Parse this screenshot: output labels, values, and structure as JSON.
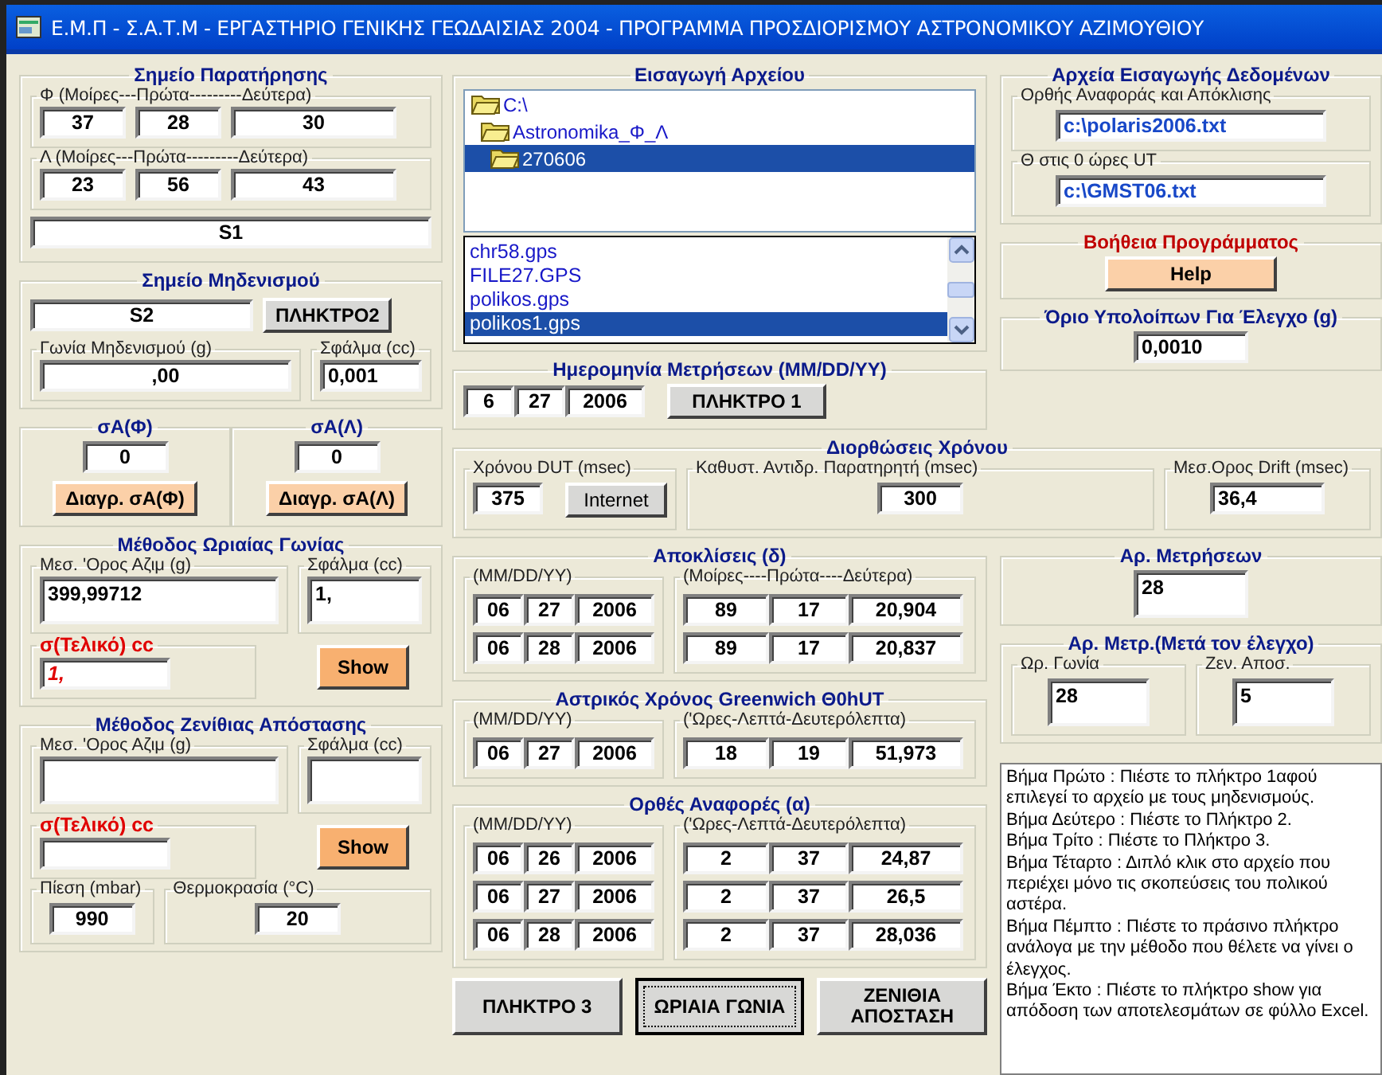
{
  "window": {
    "title": "Ε.Μ.Π - Σ.Α.Τ.Μ - ΕΡΓΑΣΤΗΡΙΟ ΓΕΝΙΚΗΣ ΓΕΩΔΑΙΣΙΑΣ 2004 - ΠΡΟΓΡΑΜΜΑ ΠΡΟΣΔΙΟΡΙΣΜΟΥ ΑΣΤΡΟΝΟΜΙΚΟΥ ΑΖΙΜΟΥΘΙΟΥ"
  },
  "observation_point": {
    "title": "Σημείο Παρατήρησης",
    "coords": [
      {
        "label": "Φ (Μοίρες---Πρώτα---------Δεύτερα)",
        "values": [
          "37",
          "28",
          "30"
        ]
      },
      {
        "label": "Λ (Μοίρες---Πρώτα---------Δεύτερα)",
        "values": [
          "23",
          "56",
          "43"
        ]
      }
    ],
    "name": "S1"
  },
  "zeroing_point": {
    "title": "Σημείο Μηδενισμού",
    "name": "S2",
    "button": "ΠΛΗΚΤΡΟ2",
    "angle": {
      "label": "Γωνία Μηδενισμού (g)",
      "value": ",00"
    },
    "error": {
      "label": "Σφάλμα (cc)",
      "value": "0,001"
    }
  },
  "sigma": [
    {
      "title": "σΑ(Φ)",
      "value": "0",
      "button": "Διαγρ. σΑ(Φ)"
    },
    {
      "title": "σΑ(Λ)",
      "value": "0",
      "button": "Διαγρ. σΑ(Λ)"
    }
  ],
  "methods": [
    {
      "title": "Μέθοδος Ωριαίας Γωνίας",
      "mean": {
        "label": "Μεσ. 'Ορος Αζιμ (g)",
        "value": "399,99712"
      },
      "error": {
        "label": "Σφάλμα (cc)",
        "value": "1,"
      },
      "final": {
        "label": "σ(Τελικό) cc",
        "value": "1,"
      },
      "button": "Show"
    },
    {
      "title": "Μέθοδος Ζενίθιας Απόστασης",
      "mean": {
        "label": "Μεσ. 'Ορος Αζιμ (g)"
      },
      "error": {
        "label": "Σφάλμα (cc)"
      },
      "final": {
        "label": "σ(Τελικό) cc"
      },
      "button": "Show"
    }
  ],
  "pressure": {
    "label": "Πίεση (mbar)",
    "value": "990"
  },
  "temperature": {
    "label": "Θερμοκρασία (°C)",
    "value": "20"
  },
  "file_input": {
    "title": "Εισαγωγή Αρχείου",
    "folders": [
      {
        "label": "C:\\",
        "selected": false,
        "children": [
          {
            "label": "Astronomika_Φ_Λ",
            "selected": false,
            "children": [
              {
                "label": "270606",
                "selected": true
              }
            ]
          }
        ]
      }
    ],
    "files": [
      {
        "label": "chr58.gps",
        "selected": false
      },
      {
        "label": "FILE27.GPS",
        "selected": false
      },
      {
        "label": "polikos.gps",
        "selected": false
      },
      {
        "label": "polikos1.gps",
        "selected": true
      }
    ]
  },
  "measurement_date": {
    "title": "Ημερομηνία Μετρήσεων (MM/DD/YY)",
    "values": [
      "6",
      "27",
      "2006"
    ],
    "button": "ΠΛΗΚΤΡΟ 1"
  },
  "data_files": {
    "title": "Αρχεία Εισαγωγής Δεδομένων",
    "fields": [
      {
        "label": "Ορθής Αναφοράς και Απόκλισης",
        "value": "c:\\polaris2006.txt"
      },
      {
        "label": "Θ στις 0 ώρες UT",
        "value": "c:\\GMST06.txt"
      }
    ]
  },
  "help": {
    "title": "Βοήθεια Προγράμματος",
    "button": "Help"
  },
  "residual_limit": {
    "title": "Όριο Υπολοίπων Για Έλεγχο (g)",
    "value": "0,0010"
  },
  "time_corrections": {
    "title": "Διορθώσεις Χρόνου",
    "dut": {
      "label": "Χρόνου DUT (msec)",
      "value": "375",
      "button": "Internet"
    },
    "delay": {
      "label": "Καθυστ. Αντιδρ. Παρατηρητή (msec)",
      "value": "300"
    },
    "drift": {
      "label": "Μεσ.Ορος Drift (msec)",
      "value": "36,4"
    }
  },
  "tables": [
    {
      "title": "Αποκλίσεις (δ)",
      "date_label": "(MM/DD/YY)",
      "value_label": "(Μοίρες----Πρώτα----Δεύτερα)",
      "rows": [
        {
          "date": [
            "06",
            "27",
            "2006"
          ],
          "values": [
            "89",
            "17",
            "20,904"
          ]
        },
        {
          "date": [
            "06",
            "28",
            "2006"
          ],
          "values": [
            "89",
            "17",
            "20,837"
          ]
        }
      ]
    },
    {
      "title": "Αστρικός Χρόνος Greenwich Θ0hUT",
      "date_label": "(MM/DD/YY)",
      "value_label": "('Ωρες-Λεπτά-Δευτερόλεπτα)",
      "rows": [
        {
          "date": [
            "06",
            "27",
            "2006"
          ],
          "values": [
            "18",
            "19",
            "51,973"
          ]
        }
      ]
    },
    {
      "title": "Ορθές Αναφορές (α)",
      "date_label": "(MM/DD/YY)",
      "value_label": "('Ωρες-Λεπτά-Δευτερόλεπτα)",
      "rows": [
        {
          "date": [
            "06",
            "26",
            "2006"
          ],
          "values": [
            "2",
            "37",
            "24,87"
          ]
        },
        {
          "date": [
            "06",
            "27",
            "2006"
          ],
          "values": [
            "2",
            "37",
            "26,5"
          ]
        },
        {
          "date": [
            "06",
            "28",
            "2006"
          ],
          "values": [
            "2",
            "37",
            "28,036"
          ]
        }
      ]
    }
  ],
  "buttons": [
    {
      "label": "ΠΛΗΚΤΡΟ 3",
      "focused": false
    },
    {
      "label": "ΩΡΙΑΙΑ ΓΩΝΙΑ",
      "focused": true
    },
    {
      "label": "ΖΕΝΙΘΙΑ ΑΠΟΣΤΑΣΗ",
      "focused": false
    }
  ],
  "measurement_count": {
    "title": "Αρ. Μετρήσεων",
    "value": "28"
  },
  "checked_count": {
    "title": "Αρ. Μετρ.(Μετά τον έλεγχο)",
    "fields": [
      {
        "label": "Ωρ. Γωνία",
        "value": "28"
      },
      {
        "label": "Ζεν. Αποσ.",
        "value": "5"
      }
    ]
  },
  "instructions": [
    "Βήμα Πρώτο : Πιέστε το πλήκτρο 1αφού επιλεγεί το αρχείο με τους μηδενισμούς.",
    "Βήμα Δεύτερο : Πιέστε το Πλήκτρο 2.",
    "Βήμα Τρίτο  : Πιέστε το Πλήκτρο 3.",
    "Βήμα Τέταρτο : Διπλό κλικ στο αρχείο που περιέχει μόνο τις σκοπεύσεις του πολικού αστέρα.",
    "Βήμα Πέμπτο : Πιέστε το πράσινο πλήκτρο ανάλογα με την μέθοδο που θέλετε να γίνει ο έλεγχος.",
    "Βήμα Έκτο : Πιέστε το πλήκτρο show για απόδοση των αποτελεσμάτων σε φύλλο Excel."
  ]
}
